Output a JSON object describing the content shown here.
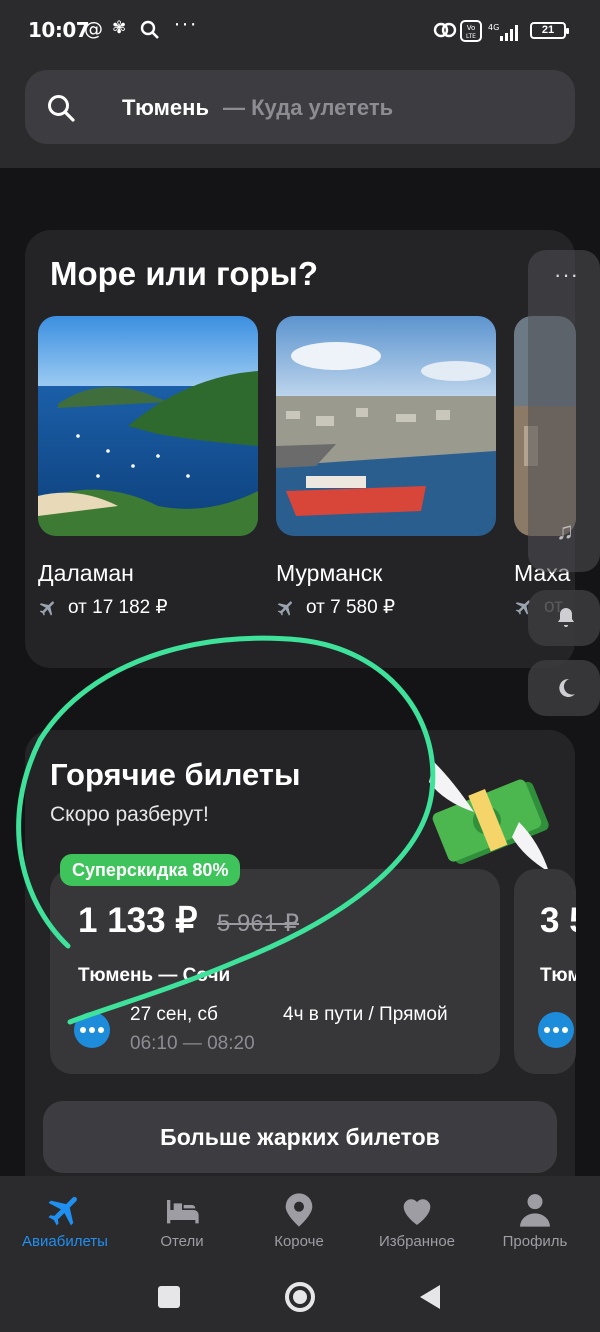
{
  "status": {
    "time": "10:07",
    "battery": "21",
    "network": "4G",
    "volte": "Vo LTE"
  },
  "search": {
    "from": "Тюмень",
    "to": "— Куда улететь"
  },
  "sea_section": {
    "title": "Море или горы?",
    "destinations": [
      {
        "name": "Даламан",
        "price": "от 17 182 ₽"
      },
      {
        "name": "Мурманск",
        "price": "от 7 580 ₽"
      },
      {
        "name": "Маха",
        "price": "от"
      }
    ]
  },
  "hot_section": {
    "title": "Горячие билеты",
    "subtitle": "Скоро разберут!",
    "badge": "Суперскидка 80%",
    "tickets": [
      {
        "price": "1 133 ₽",
        "old_price": "5 961 ₽",
        "route": "Тюмень — Сочи",
        "date": "27 сен, сб",
        "time": "06:10 — 08:20",
        "duration": "4ч в пути / Прямой"
      },
      {
        "price": "3 5",
        "route": "Тюм"
      }
    ],
    "more_button": "Больше жарких билетов"
  },
  "nav": [
    {
      "label": "Авиабилеты",
      "icon": "plane-icon",
      "active": true
    },
    {
      "label": "Отели",
      "icon": "bed-icon",
      "active": false
    },
    {
      "label": "Короче",
      "icon": "pin-icon",
      "active": false
    },
    {
      "label": "Избранное",
      "icon": "heart-icon",
      "active": false
    },
    {
      "label": "Профиль",
      "icon": "person-icon",
      "active": false
    }
  ],
  "colors": {
    "accent": "#1f8ff0",
    "badge": "#3ec45b",
    "annotation": "#3ee29a",
    "card": "#242427"
  }
}
